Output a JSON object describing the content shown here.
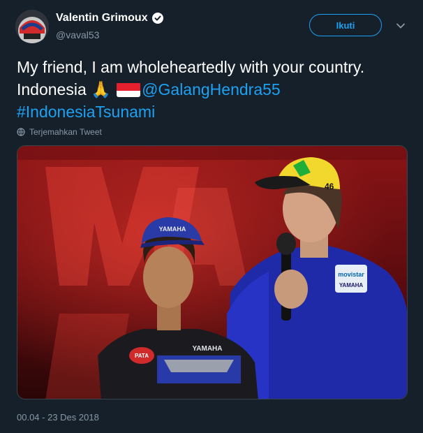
{
  "user": {
    "display_name": "Valentin Grimoux",
    "handle": "@vaval53"
  },
  "follow_button": {
    "label": "Ikuti"
  },
  "tweet": {
    "text_prefix": "My friend, I am wholeheartedly with your country.  Indonesia ",
    "emoji_pray": "🙏",
    "mention": "@GalangHendra55",
    "hashtag": "#IndonesiaTsunami",
    "translate_label": "Terjemahkan Tweet",
    "timestamp": "00.04 - 23 Des 2018"
  },
  "photo": {
    "cap_logo": "YAMAHA",
    "shirt_logo": "YAMAHA",
    "shirt_sponsor": "PATA",
    "jacket_sponsor": "movistar",
    "jacket_logo": "YAMAHA",
    "cap_number": "46"
  },
  "colors": {
    "background": "#15202b",
    "accent": "#1da1f2",
    "muted": "#8899a6"
  },
  "icons": {
    "verified": "verified-badge-icon",
    "chevron": "chevron-down-icon",
    "translate": "globe-icon"
  }
}
